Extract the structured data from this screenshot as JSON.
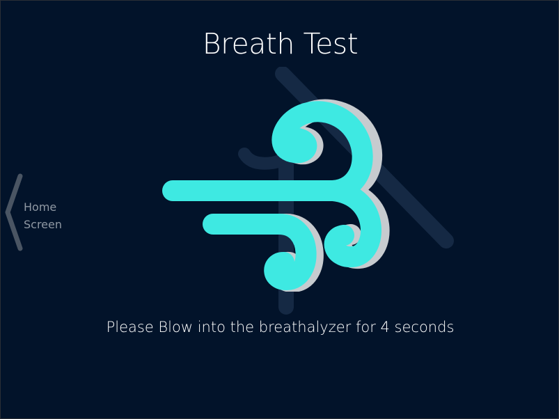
{
  "page": {
    "title": "Breath Test",
    "instruction": "Please Blow into the breathalyzer for 4 seconds"
  },
  "nav": {
    "back_label_line1": "Home",
    "back_label_line2": "Screen"
  },
  "icons": {
    "main": "wind-icon",
    "back": "chevron-left-icon",
    "background": "breathalyzer-watermark-icon"
  },
  "colors": {
    "background": "#02132a",
    "accent": "#3ee9e2",
    "accent_shadow": "#c7cbcf",
    "muted_text": "#8f98a3"
  }
}
